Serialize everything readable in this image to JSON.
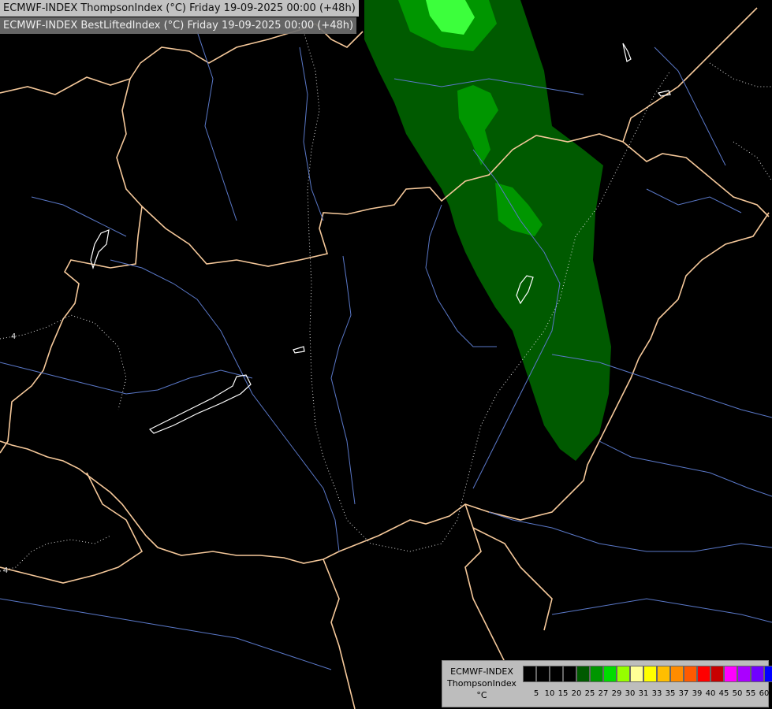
{
  "header": {
    "line1": "ECMWF-INDEX ThompsonIndex (°C) Friday 19-09-2025 00:00 (+48h)",
    "line2": "ECMWF-INDEX BestLiftedIndex (°C) Friday 19-09-2025 00:00 (+48h)"
  },
  "contour_labels": {
    "left": "4",
    "lower_left": "4"
  },
  "legend": {
    "title_line1": "ECMWF-INDEX",
    "title_line2": "ThompsonIndex",
    "unit": "°C",
    "ticks": [
      "5",
      "10",
      "15",
      "20",
      "25",
      "27",
      "29",
      "30",
      "31",
      "33",
      "35",
      "37",
      "39",
      "40",
      "45",
      "50",
      "55",
      "60"
    ],
    "colors": [
      "#000000",
      "#000000",
      "#000000",
      "#000000",
      "#005a00",
      "#009600",
      "#00dc00",
      "#96ff00",
      "#ffff96",
      "#ffff00",
      "#ffbe00",
      "#ff8c00",
      "#ff5a00",
      "#ff0000",
      "#c80000",
      "#ff00ff",
      "#aa00ff",
      "#7000ff",
      "#0000ff"
    ]
  },
  "colors": {
    "background": "#000000",
    "border": "#f5c89a",
    "river": "#5a78c8",
    "lake": "#ffffff",
    "green_dark": "#005a00",
    "green_mid": "#009600",
    "green_light": "#00dc00",
    "green_bright": "#3cff3c"
  }
}
